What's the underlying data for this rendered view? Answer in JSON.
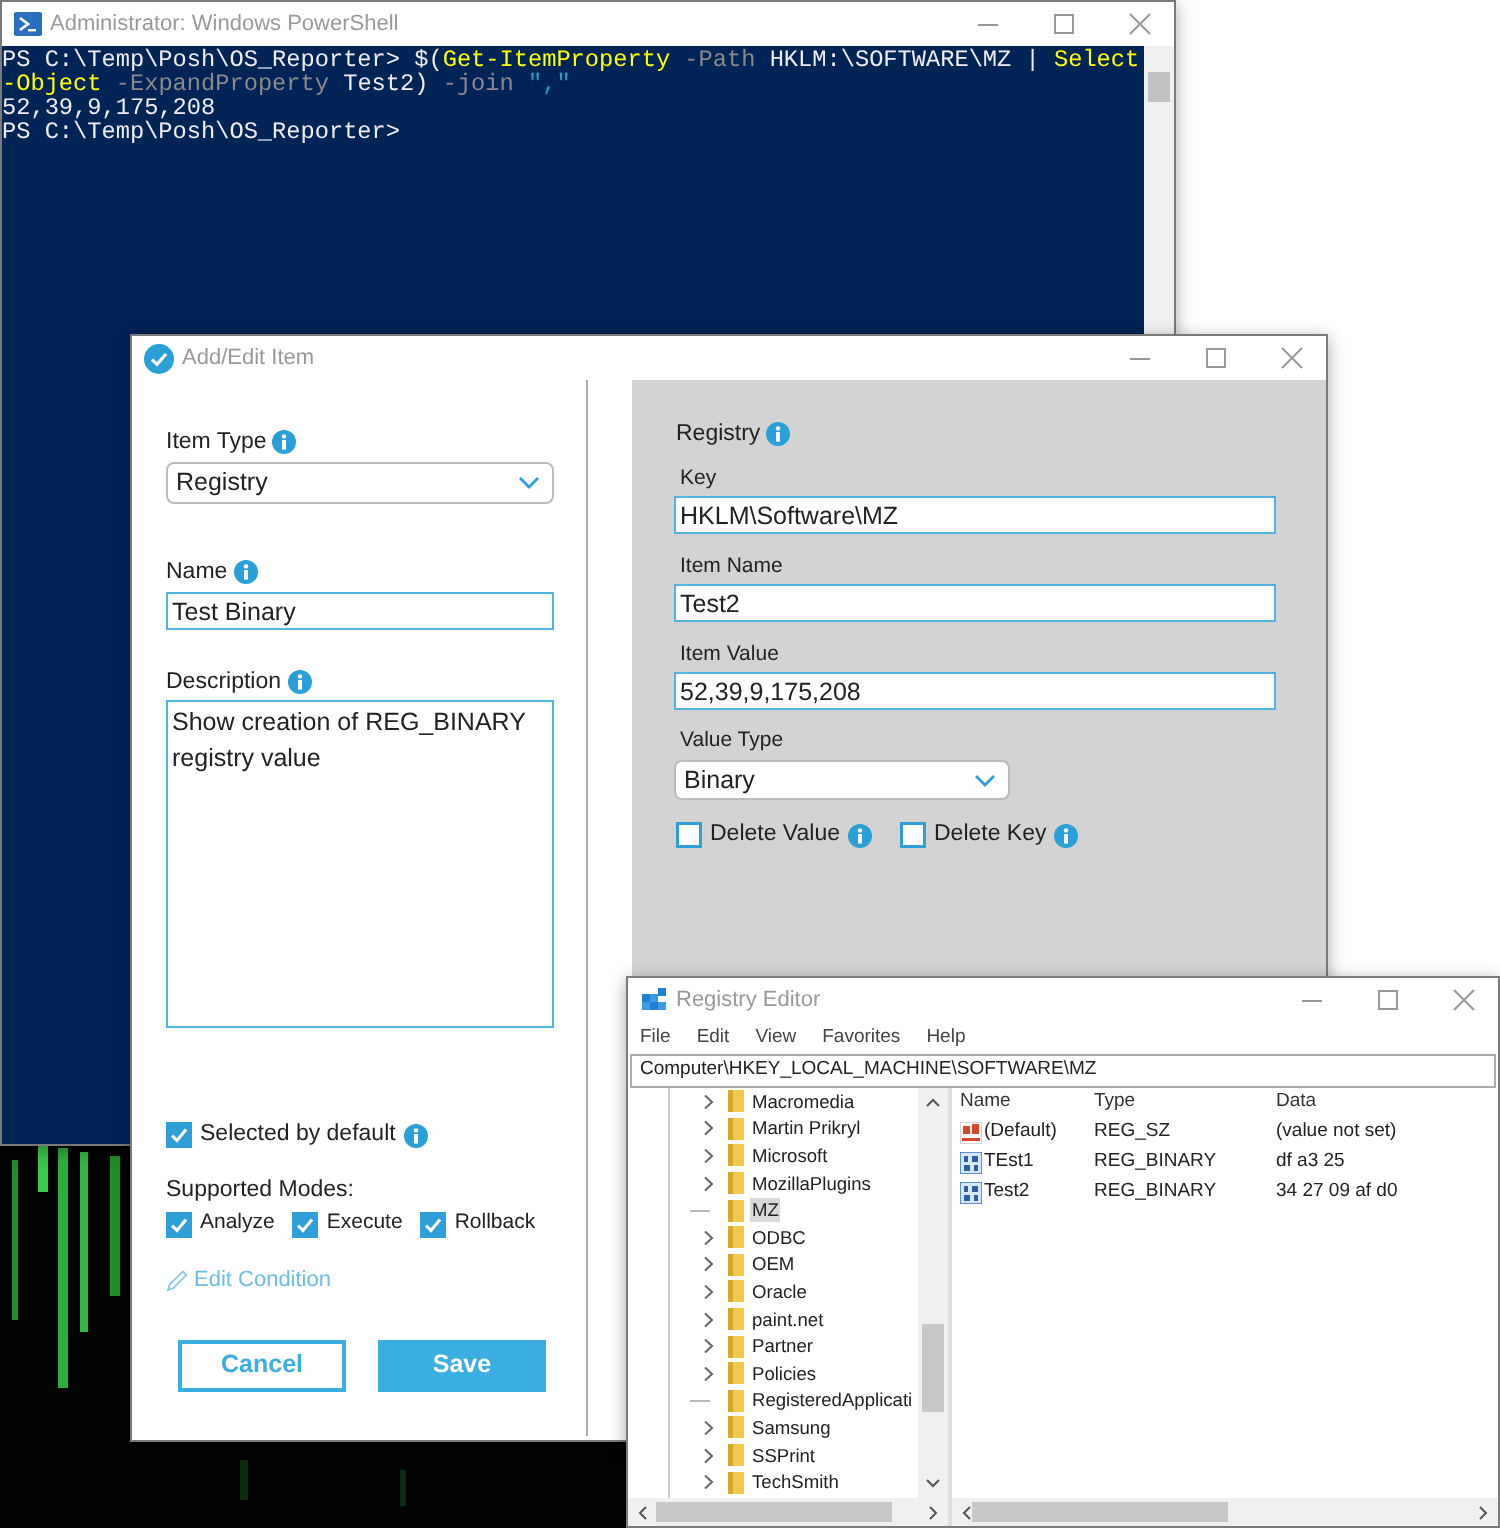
{
  "powershell": {
    "title": "Administrator: Windows PowerShell",
    "lines": [
      [
        {
          "text": "PS C:\\Temp\\Posh\\OS_Reporter> $(",
          "kind": "plain"
        },
        {
          "text": "Get-ItemProperty",
          "kind": "cmdlet"
        },
        {
          "text": " -Path",
          "kind": "param"
        },
        {
          "text": " HKLM:\\SOFTWARE\\MZ | ",
          "kind": "plain"
        },
        {
          "text": "Select",
          "kind": "cmdlet"
        }
      ],
      [
        {
          "text": "-Object",
          "kind": "cmdlet"
        },
        {
          "text": " -ExpandProperty",
          "kind": "param"
        },
        {
          "text": " Test2) ",
          "kind": "plain"
        },
        {
          "text": "-join",
          "kind": "param"
        },
        {
          "text": " \",\"",
          "kind": "string"
        }
      ],
      [
        {
          "text": "52,39,9,175,208",
          "kind": "plain"
        }
      ],
      [
        {
          "text": "PS C:\\Temp\\Posh\\OS_Reporter>",
          "kind": "plain"
        }
      ]
    ]
  },
  "add_edit": {
    "title": "Add/Edit Item",
    "item_type": {
      "label": "Item Type",
      "value": "Registry"
    },
    "name": {
      "label": "Name",
      "value": "Test Binary"
    },
    "description": {
      "label": "Description",
      "value": "Show creation of REG_BINARY registry value"
    },
    "selected_by_default": {
      "label": "Selected by default",
      "checked": true
    },
    "supported_modes": {
      "label": "Supported Modes:",
      "modes": [
        {
          "label": "Analyze",
          "checked": true
        },
        {
          "label": "Execute",
          "checked": true
        },
        {
          "label": "Rollback",
          "checked": true
        }
      ]
    },
    "edit_condition": "Edit Condition",
    "buttons": [
      {
        "label": "Cancel",
        "kind": "secondary"
      },
      {
        "label": "Save",
        "kind": "primary"
      }
    ],
    "registry": {
      "title": "Registry",
      "key": {
        "label": "Key",
        "value": "HKLM\\Software\\MZ"
      },
      "item_name": {
        "label": "Item Name",
        "value": "Test2"
      },
      "item_value": {
        "label": "Item Value",
        "value": "52,39,9,175,208"
      },
      "value_type": {
        "label": "Value Type",
        "value": "Binary"
      },
      "options": [
        {
          "label": "Delete Value",
          "checked": false
        },
        {
          "label": "Delete Key",
          "checked": false
        }
      ]
    }
  },
  "registry_editor": {
    "title": "Registry Editor",
    "menu": [
      "File",
      "Edit",
      "View",
      "Favorites",
      "Help"
    ],
    "address": "Computer\\HKEY_LOCAL_MACHINE\\SOFTWARE\\MZ",
    "tree": [
      {
        "label": "Macromedia",
        "expandable": true,
        "selected": false
      },
      {
        "label": "Martin Prikryl",
        "expandable": true,
        "selected": false
      },
      {
        "label": "Microsoft",
        "expandable": true,
        "selected": false
      },
      {
        "label": "MozillaPlugins",
        "expandable": true,
        "selected": false
      },
      {
        "label": "MZ",
        "expandable": false,
        "selected": true
      },
      {
        "label": "ODBC",
        "expandable": true,
        "selected": false
      },
      {
        "label": "OEM",
        "expandable": true,
        "selected": false
      },
      {
        "label": "Oracle",
        "expandable": true,
        "selected": false
      },
      {
        "label": "paint.net",
        "expandable": true,
        "selected": false
      },
      {
        "label": "Partner",
        "expandable": true,
        "selected": false
      },
      {
        "label": "Policies",
        "expandable": true,
        "selected": false
      },
      {
        "label": "RegisteredApplicati",
        "expandable": false,
        "selected": false
      },
      {
        "label": "Samsung",
        "expandable": true,
        "selected": false
      },
      {
        "label": "SSPrint",
        "expandable": true,
        "selected": false
      },
      {
        "label": "TechSmith",
        "expandable": true,
        "selected": false
      }
    ],
    "columns": [
      "Name",
      "Type",
      "Data"
    ],
    "rows": [
      {
        "name": "(Default)",
        "type": "REG_SZ",
        "data": "(value not set)",
        "kind": "string"
      },
      {
        "name": "TEst1",
        "type": "REG_BINARY",
        "data": "df a3 25",
        "kind": "binary"
      },
      {
        "name": "Test2",
        "type": "REG_BINARY",
        "data": "34 27 09 af d0",
        "kind": "binary"
      }
    ]
  }
}
